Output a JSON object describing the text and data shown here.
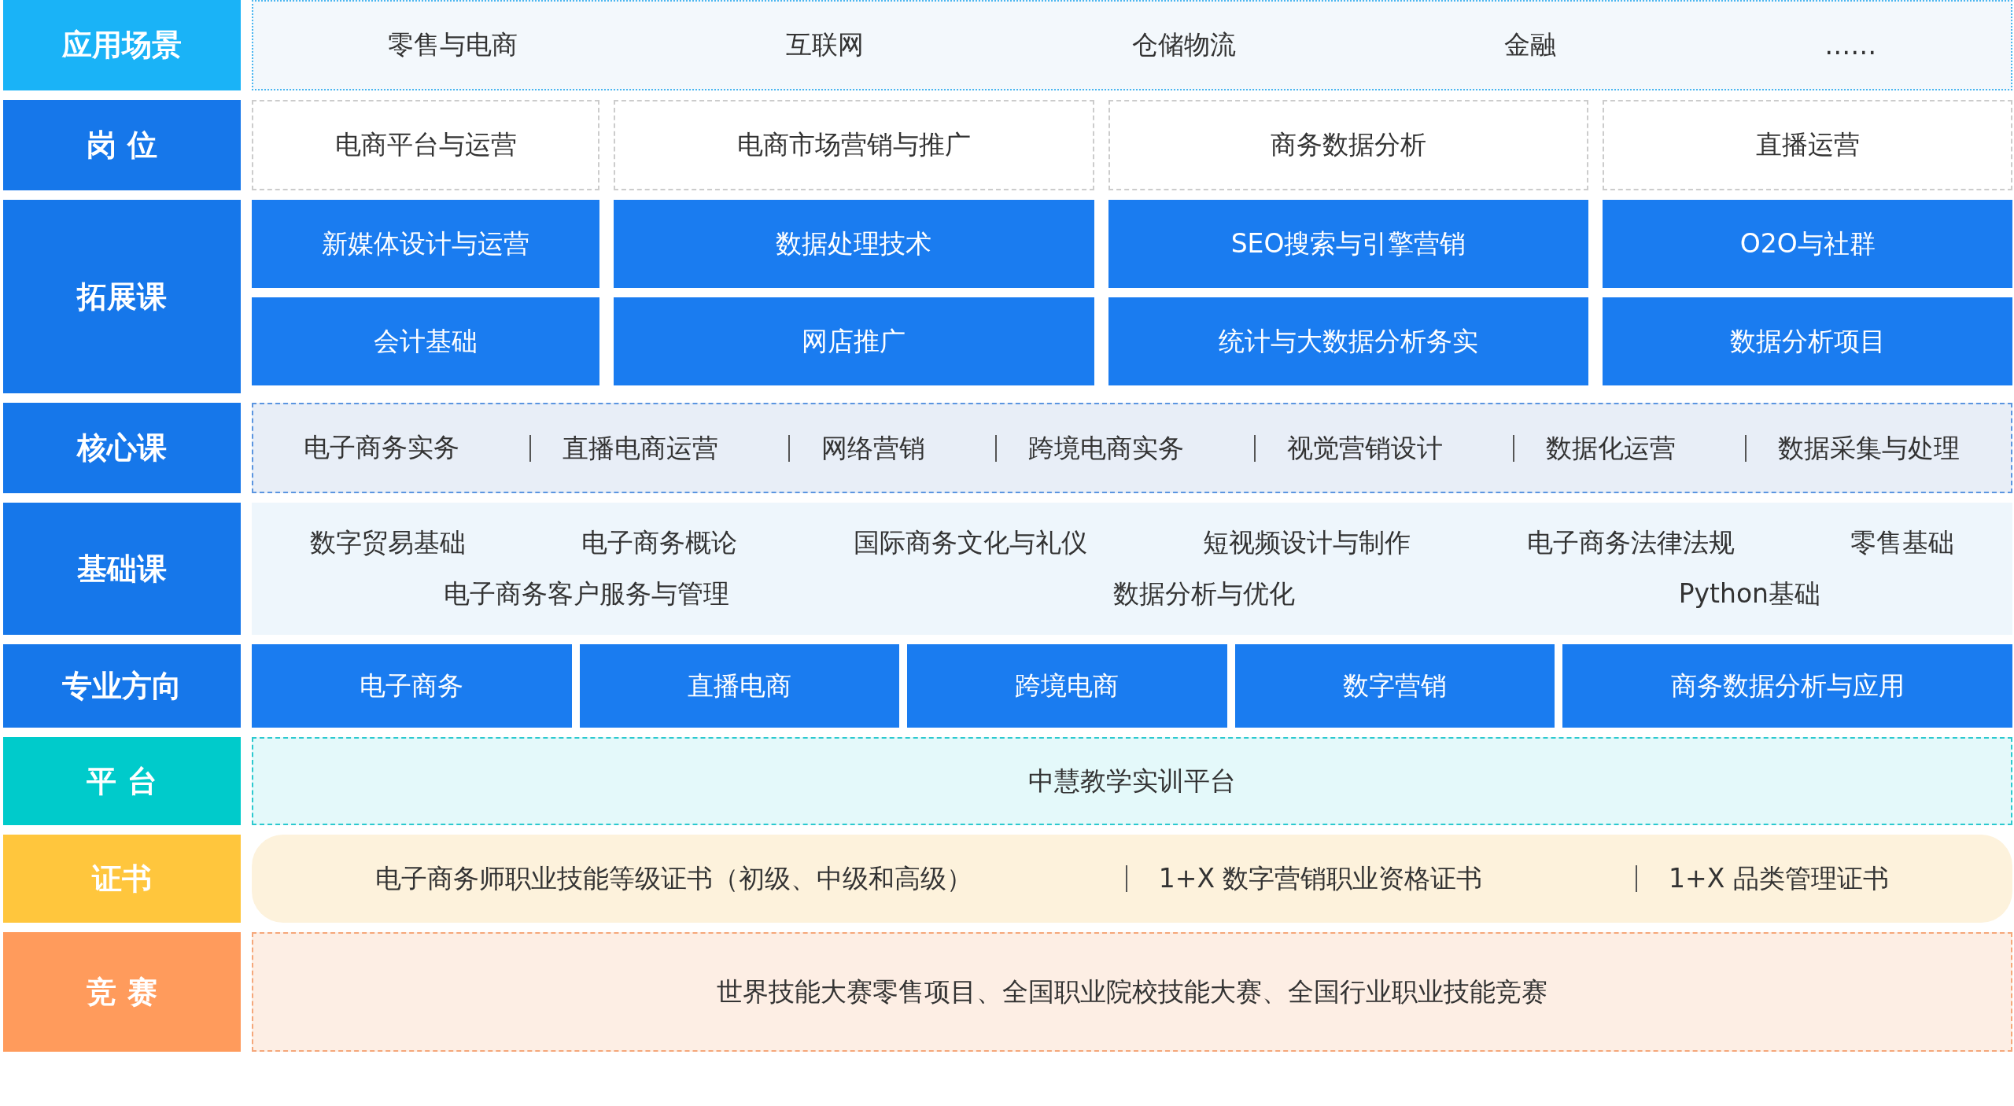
{
  "rows": [
    {
      "kind": "scenes",
      "label": "应用场景",
      "color": "#1ab3f7",
      "items": [
        "零售与电商",
        "互联网",
        "仓储物流",
        "金融",
        "……"
      ]
    },
    {
      "kind": "jobs",
      "label": "岗 位",
      "color": "#1677ea",
      "items": [
        "电商平台与运营",
        "电商市场营销与推广",
        "商务数据分析",
        "直播运营"
      ]
    },
    {
      "kind": "electives",
      "label": "拓展课",
      "color": "#1677ea",
      "grid": [
        [
          "新媒体设计与运营",
          "数据处理技术",
          "SEO搜索与引擎营销",
          "O2O与社群"
        ],
        [
          "会计基础",
          "网店推广",
          "统计与大数据分析务实",
          "数据分析项目"
        ]
      ]
    },
    {
      "kind": "core",
      "label": "核心课",
      "color": "#1677ea",
      "items": [
        "电子商务实务",
        "直播电商运营",
        "网络营销",
        "跨境电商实务",
        "视觉营销设计",
        "数据化运营",
        "数据采集与处理"
      ]
    },
    {
      "kind": "basics",
      "label": "基础课",
      "color": "#1677ea",
      "lines": [
        [
          "数字贸易基础",
          "电子商务概论",
          "国际商务文化与礼仪",
          "短视频设计与制作",
          "电子商务法律法规",
          "零售基础"
        ],
        [
          "电子商务客户服务与管理",
          "数据分析与优化",
          "Python基础"
        ]
      ]
    },
    {
      "kind": "majors",
      "label": "专业方向",
      "color": "#1677ea",
      "items": [
        "电子商务",
        "直播电商",
        "跨境电商",
        "数字营销",
        "商务数据分析与应用"
      ]
    },
    {
      "kind": "platform",
      "label": "平 台",
      "color": "#00cbcb",
      "items": [
        "中慧教学实训平台"
      ]
    },
    {
      "kind": "certs",
      "label": "证书",
      "color": "#ffc63d",
      "items": [
        "电子商务师职业技能等级证书（初级、中级和高级）",
        "1+X 数字营销职业资格证书",
        "1+X 品类管理证书"
      ]
    },
    {
      "kind": "contests",
      "label": "竞 赛",
      "color": "#ff9b5c",
      "items": [
        "世界技能大赛零售项目、全国职业院校技能大赛、全国行业职业技能竞赛"
      ]
    }
  ]
}
